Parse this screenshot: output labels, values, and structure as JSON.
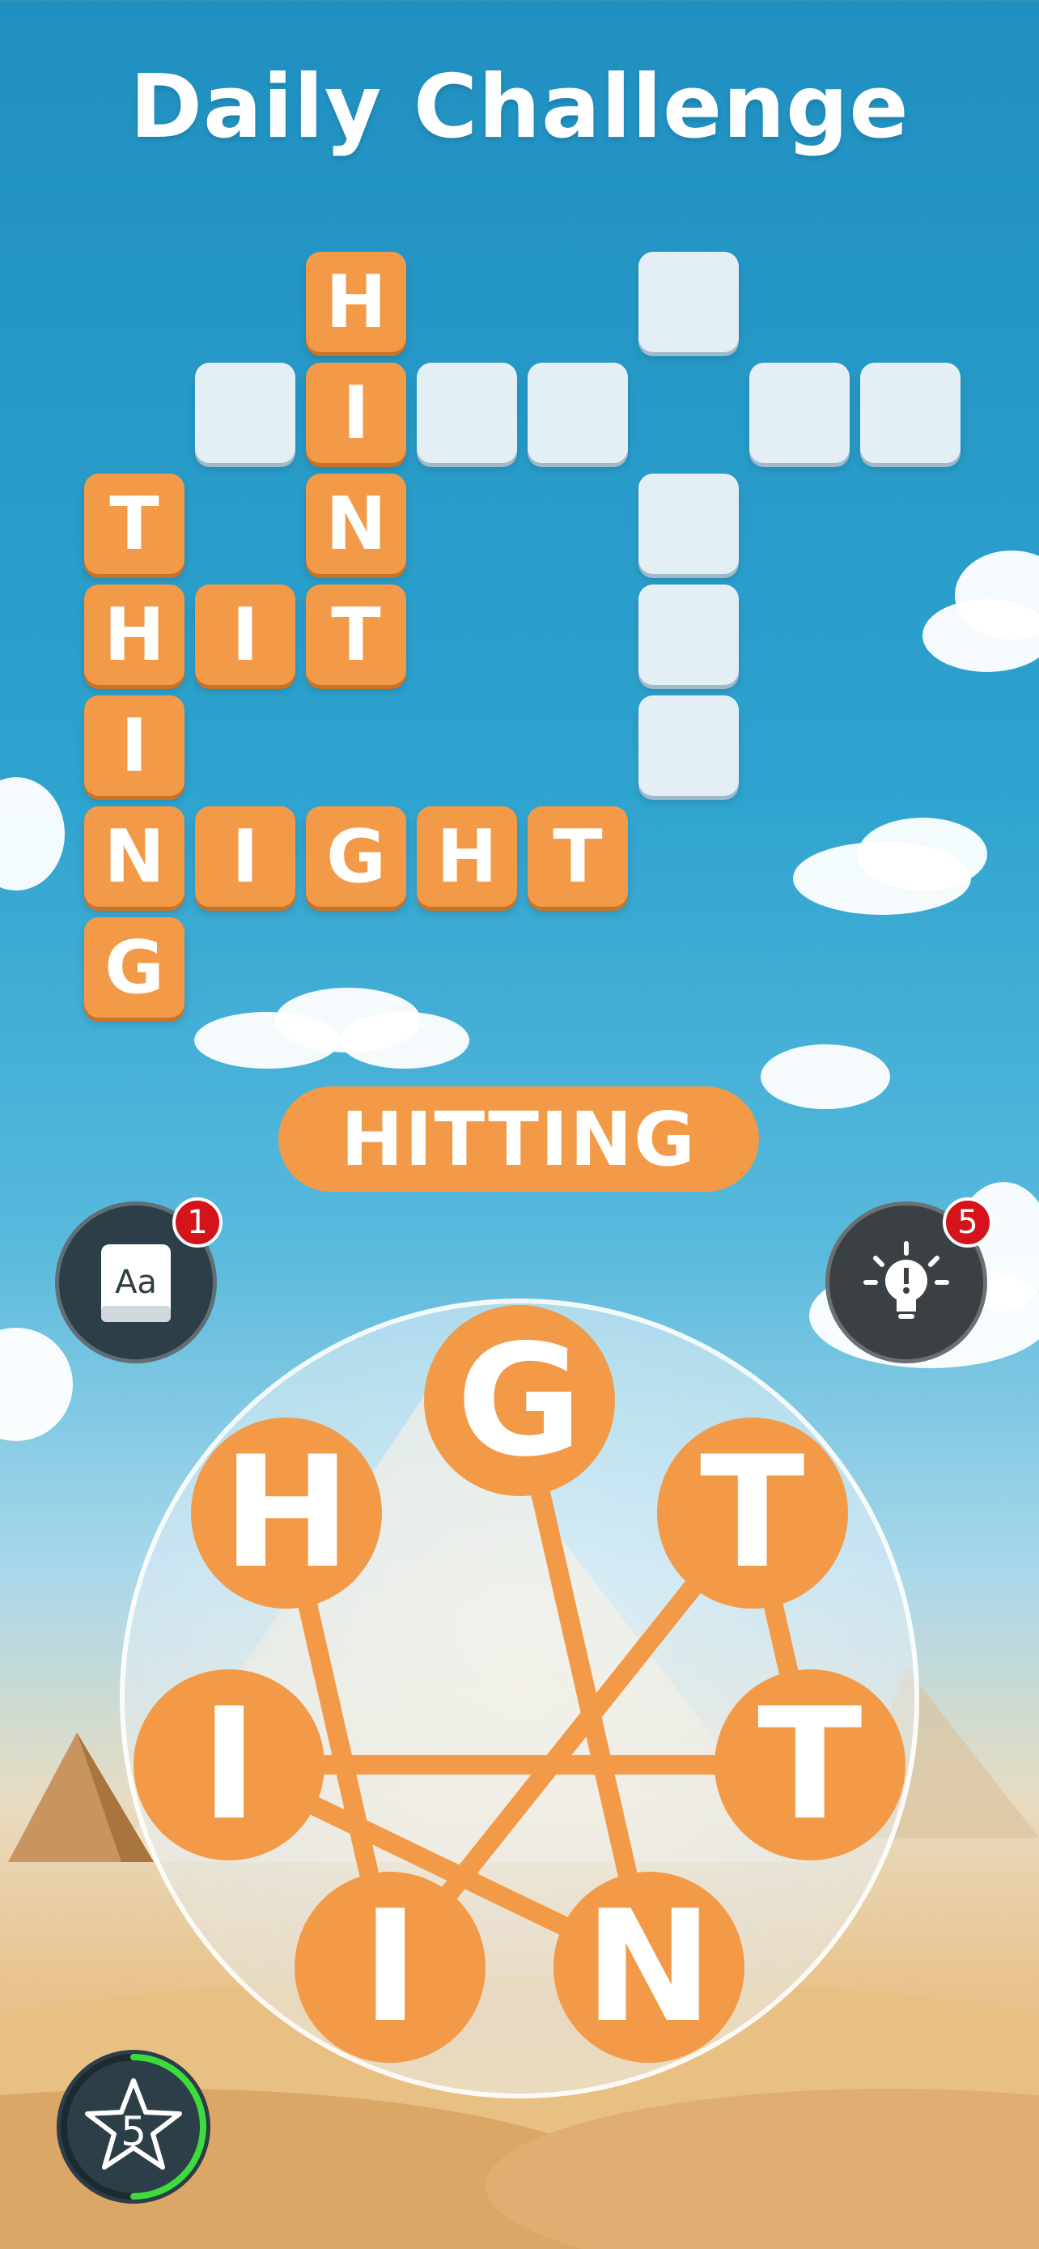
{
  "title": "Daily Challenge",
  "grid": {
    "filled": [
      {
        "letter": "H",
        "col": 2,
        "row": 0
      },
      {
        "letter": "I",
        "col": 2,
        "row": 1
      },
      {
        "letter": "N",
        "col": 2,
        "row": 2
      },
      {
        "letter": "T",
        "col": 2,
        "row": 3
      },
      {
        "letter": "T",
        "col": 0,
        "row": 2
      },
      {
        "letter": "H",
        "col": 0,
        "row": 3
      },
      {
        "letter": "I",
        "col": 1,
        "row": 3
      },
      {
        "letter": "I",
        "col": 0,
        "row": 4
      },
      {
        "letter": "N",
        "col": 0,
        "row": 5
      },
      {
        "letter": "I",
        "col": 1,
        "row": 5
      },
      {
        "letter": "G",
        "col": 2,
        "row": 5
      },
      {
        "letter": "H",
        "col": 3,
        "row": 5
      },
      {
        "letter": "T",
        "col": 4,
        "row": 5
      },
      {
        "letter": "G",
        "col": 0,
        "row": 6
      }
    ],
    "empty": [
      {
        "col": 5,
        "row": 0
      },
      {
        "col": 1,
        "row": 1
      },
      {
        "col": 3,
        "row": 1
      },
      {
        "col": 4,
        "row": 1
      },
      {
        "col": 6,
        "row": 1
      },
      {
        "col": 7,
        "row": 1
      },
      {
        "col": 5,
        "row": 2
      },
      {
        "col": 5,
        "row": 3
      },
      {
        "col": 5,
        "row": 4
      }
    ],
    "medal": {
      "col": 5,
      "row": 1,
      "icon": "medal-icon"
    }
  },
  "current_word": "HITTING",
  "dictionary": {
    "icon": "dictionary-icon",
    "label": "Aa",
    "badge": "1"
  },
  "hint": {
    "icon": "lightbulb-icon",
    "badge": "5"
  },
  "wheel": {
    "letters": [
      "G",
      "T",
      "T",
      "N",
      "I",
      "I",
      "H"
    ],
    "path": [
      6,
      4,
      1,
      2,
      5,
      3,
      0
    ]
  },
  "stars": {
    "icon": "star-icon",
    "count": "5",
    "progress": 0.5
  },
  "colors": {
    "tile": "#f39a48",
    "empty_tile": "#e3eff5",
    "badge": "#d4131a",
    "button": "#2c3e48"
  }
}
